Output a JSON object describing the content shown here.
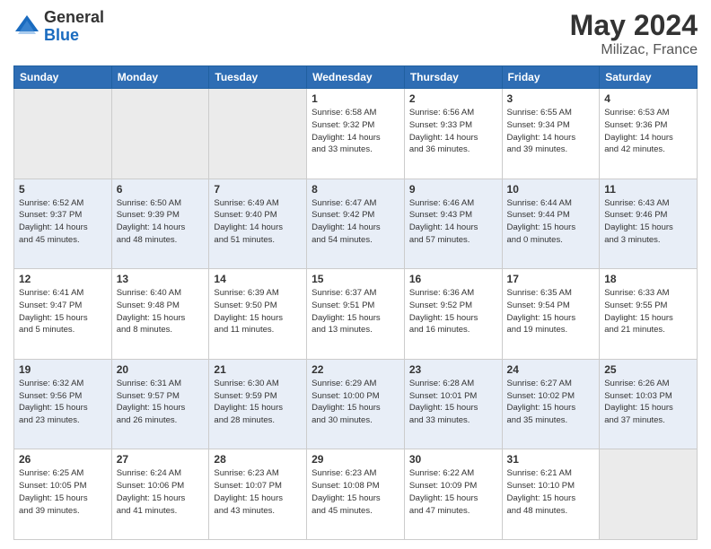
{
  "header": {
    "logo_general": "General",
    "logo_blue": "Blue",
    "title": "May 2024",
    "subtitle": "Milizac, France"
  },
  "days_of_week": [
    "Sunday",
    "Monday",
    "Tuesday",
    "Wednesday",
    "Thursday",
    "Friday",
    "Saturday"
  ],
  "weeks": [
    {
      "days": [
        {
          "num": "",
          "info": ""
        },
        {
          "num": "",
          "info": ""
        },
        {
          "num": "",
          "info": ""
        },
        {
          "num": "1",
          "info": "Sunrise: 6:58 AM\nSunset: 9:32 PM\nDaylight: 14 hours\nand 33 minutes."
        },
        {
          "num": "2",
          "info": "Sunrise: 6:56 AM\nSunset: 9:33 PM\nDaylight: 14 hours\nand 36 minutes."
        },
        {
          "num": "3",
          "info": "Sunrise: 6:55 AM\nSunset: 9:34 PM\nDaylight: 14 hours\nand 39 minutes."
        },
        {
          "num": "4",
          "info": "Sunrise: 6:53 AM\nSunset: 9:36 PM\nDaylight: 14 hours\nand 42 minutes."
        }
      ]
    },
    {
      "days": [
        {
          "num": "5",
          "info": "Sunrise: 6:52 AM\nSunset: 9:37 PM\nDaylight: 14 hours\nand 45 minutes."
        },
        {
          "num": "6",
          "info": "Sunrise: 6:50 AM\nSunset: 9:39 PM\nDaylight: 14 hours\nand 48 minutes."
        },
        {
          "num": "7",
          "info": "Sunrise: 6:49 AM\nSunset: 9:40 PM\nDaylight: 14 hours\nand 51 minutes."
        },
        {
          "num": "8",
          "info": "Sunrise: 6:47 AM\nSunset: 9:42 PM\nDaylight: 14 hours\nand 54 minutes."
        },
        {
          "num": "9",
          "info": "Sunrise: 6:46 AM\nSunset: 9:43 PM\nDaylight: 14 hours\nand 57 minutes."
        },
        {
          "num": "10",
          "info": "Sunrise: 6:44 AM\nSunset: 9:44 PM\nDaylight: 15 hours\nand 0 minutes."
        },
        {
          "num": "11",
          "info": "Sunrise: 6:43 AM\nSunset: 9:46 PM\nDaylight: 15 hours\nand 3 minutes."
        }
      ]
    },
    {
      "days": [
        {
          "num": "12",
          "info": "Sunrise: 6:41 AM\nSunset: 9:47 PM\nDaylight: 15 hours\nand 5 minutes."
        },
        {
          "num": "13",
          "info": "Sunrise: 6:40 AM\nSunset: 9:48 PM\nDaylight: 15 hours\nand 8 minutes."
        },
        {
          "num": "14",
          "info": "Sunrise: 6:39 AM\nSunset: 9:50 PM\nDaylight: 15 hours\nand 11 minutes."
        },
        {
          "num": "15",
          "info": "Sunrise: 6:37 AM\nSunset: 9:51 PM\nDaylight: 15 hours\nand 13 minutes."
        },
        {
          "num": "16",
          "info": "Sunrise: 6:36 AM\nSunset: 9:52 PM\nDaylight: 15 hours\nand 16 minutes."
        },
        {
          "num": "17",
          "info": "Sunrise: 6:35 AM\nSunset: 9:54 PM\nDaylight: 15 hours\nand 19 minutes."
        },
        {
          "num": "18",
          "info": "Sunrise: 6:33 AM\nSunset: 9:55 PM\nDaylight: 15 hours\nand 21 minutes."
        }
      ]
    },
    {
      "days": [
        {
          "num": "19",
          "info": "Sunrise: 6:32 AM\nSunset: 9:56 PM\nDaylight: 15 hours\nand 23 minutes."
        },
        {
          "num": "20",
          "info": "Sunrise: 6:31 AM\nSunset: 9:57 PM\nDaylight: 15 hours\nand 26 minutes."
        },
        {
          "num": "21",
          "info": "Sunrise: 6:30 AM\nSunset: 9:59 PM\nDaylight: 15 hours\nand 28 minutes."
        },
        {
          "num": "22",
          "info": "Sunrise: 6:29 AM\nSunset: 10:00 PM\nDaylight: 15 hours\nand 30 minutes."
        },
        {
          "num": "23",
          "info": "Sunrise: 6:28 AM\nSunset: 10:01 PM\nDaylight: 15 hours\nand 33 minutes."
        },
        {
          "num": "24",
          "info": "Sunrise: 6:27 AM\nSunset: 10:02 PM\nDaylight: 15 hours\nand 35 minutes."
        },
        {
          "num": "25",
          "info": "Sunrise: 6:26 AM\nSunset: 10:03 PM\nDaylight: 15 hours\nand 37 minutes."
        }
      ]
    },
    {
      "days": [
        {
          "num": "26",
          "info": "Sunrise: 6:25 AM\nSunset: 10:05 PM\nDaylight: 15 hours\nand 39 minutes."
        },
        {
          "num": "27",
          "info": "Sunrise: 6:24 AM\nSunset: 10:06 PM\nDaylight: 15 hours\nand 41 minutes."
        },
        {
          "num": "28",
          "info": "Sunrise: 6:23 AM\nSunset: 10:07 PM\nDaylight: 15 hours\nand 43 minutes."
        },
        {
          "num": "29",
          "info": "Sunrise: 6:23 AM\nSunset: 10:08 PM\nDaylight: 15 hours\nand 45 minutes."
        },
        {
          "num": "30",
          "info": "Sunrise: 6:22 AM\nSunset: 10:09 PM\nDaylight: 15 hours\nand 47 minutes."
        },
        {
          "num": "31",
          "info": "Sunrise: 6:21 AM\nSunset: 10:10 PM\nDaylight: 15 hours\nand 48 minutes."
        },
        {
          "num": "",
          "info": ""
        }
      ]
    }
  ]
}
